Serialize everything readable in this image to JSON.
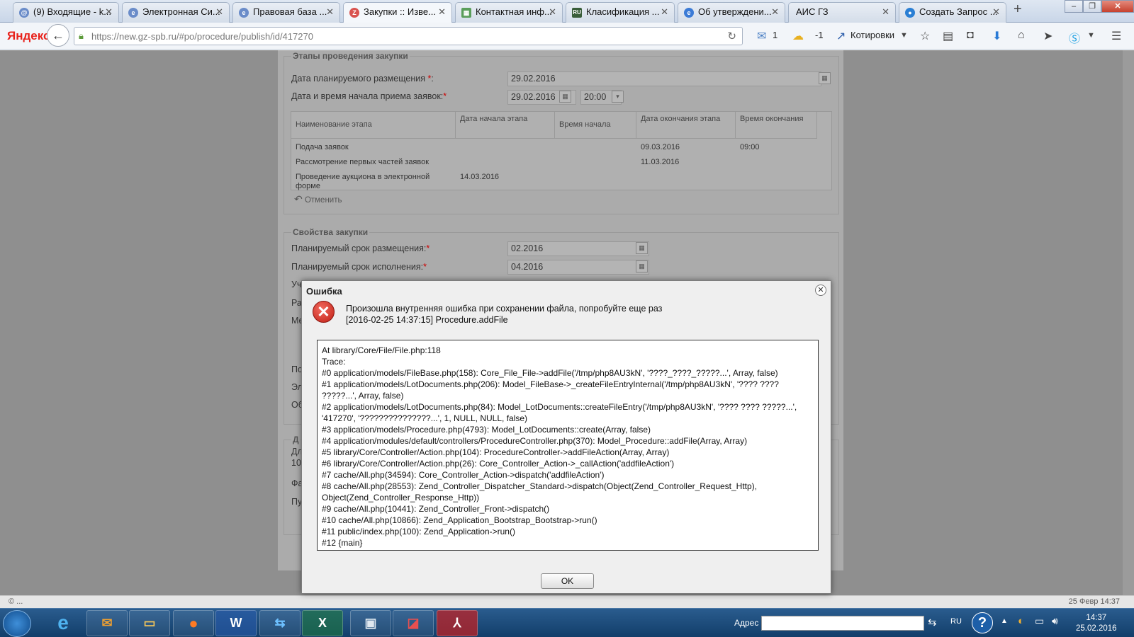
{
  "browser": {
    "tabs": [
      {
        "label": "(9) Входящие - k...",
        "icon": "mail-icon"
      },
      {
        "label": "Электронная Си...",
        "icon": "globe-icon"
      },
      {
        "label": "Правовая база ...",
        "icon": "globe-icon"
      },
      {
        "label": "Закупки :: Изве...",
        "icon": "gz-icon"
      },
      {
        "label": "Контактная инф...",
        "icon": "page-icon"
      },
      {
        "label": "Класификация ...",
        "icon": "ru-icon"
      },
      {
        "label": "Об утверждени...",
        "icon": "e-icon"
      },
      {
        "label": "АИС ГЗ",
        "icon": ""
      },
      {
        "label": "Создать Запрос ...",
        "icon": "globe-icon"
      }
    ],
    "new_tab": "+",
    "logo": "Яндекс",
    "url": "https://new.gz-spb.ru/#po/procedure/publish/id/417270",
    "mail_count": "1",
    "weather": "-1",
    "quotes_label": "Котировки"
  },
  "stages": {
    "legend": "Этапы проведения закупки",
    "planned_date_label": "Дата планируемого размещения",
    "planned_date_suffix": ":",
    "planned_date_value": "29.02.2016",
    "start_label": "Дата и время начала приема заявок:",
    "start_date": "29.02.2016",
    "start_time": "20:00",
    "req_mark": "*",
    "table_headers": [
      "Наименование этапа",
      "Дата начала этапа",
      "Время начала",
      "Дата окончания этапа",
      "Время окончания"
    ],
    "rows": [
      [
        "Подача заявок",
        "",
        "",
        "09.03.2016",
        "09:00"
      ],
      [
        "Рассмотрение первых частей заявок",
        "",
        "",
        "11.03.2016",
        ""
      ],
      [
        "Проведение аукциона в электронной форме",
        "14.03.2016",
        "",
        "",
        ""
      ]
    ],
    "cancel_label": "Отменить"
  },
  "props": {
    "legend": "Свойства закупки",
    "placement_label": "Планируемый срок размещения:",
    "placement_value": "02.2016",
    "execution_label": "Планируемый срок исполнения:",
    "execution_value": "04.2016",
    "partial_labels": [
      "Уч",
      "Ра",
      "Ме",
      "По",
      "Эл",
      "Об"
    ]
  },
  "lower": {
    "legend_partial": "Д",
    "partial_labels": [
      "Дл",
      "10",
      "Фа",
      "Пу"
    ]
  },
  "dialog": {
    "title": "Ошибка",
    "message_line1": "Произошла внутренняя ошибка при сохранении файла, попробуйте еще раз",
    "message_line2": "[2016-02-25 14:37:15] Procedure.addFile",
    "trace_lines": [
      "At library/Core/File/File.php:118",
      "Trace:",
      "#0 application/models/FileBase.php(158): Core_File_File->addFile('/tmp/php8AU3kN', '????_????_?????...', Array, false)",
      "#1 application/models/LotDocuments.php(206): Model_FileBase->_createFileEntryInternal('/tmp/php8AU3kN', '???? ???? ?????...', Array, false)",
      "#2 application/models/LotDocuments.php(84): Model_LotDocuments::createFileEntry('/tmp/php8AU3kN', '???? ???? ?????...', '417270', '???????????????...', 1, NULL, NULL, false)",
      "#3 application/models/Procedure.php(4793): Model_LotDocuments::create(Array, false)",
      "#4 application/modules/default/controllers/ProcedureController.php(370): Model_Procedure::addFile(Array, Array)",
      "#5 library/Core/Controller/Action.php(104): ProcedureController->addFileAction(Array, Array)",
      "#6 library/Core/Controller/Action.php(26): Core_Controller_Action->_callAction('addfileAction')",
      "#7 cache/All.php(34594): Core_Controller_Action->dispatch('addfileAction')",
      "#8 cache/All.php(28553): Zend_Controller_Dispatcher_Standard->dispatch(Object(Zend_Controller_Request_Http), Object(Zend_Controller_Response_Http))",
      "#9 cache/All.php(10441): Zend_Controller_Front->dispatch()",
      "#10 cache/All.php(10866): Zend_Application_Bootstrap_Bootstrap->run()",
      "#11 public/index.php(100): Zend_Application->run()",
      "#12 {main}"
    ],
    "ok_label": "OK"
  },
  "statusbar": {
    "left": "© ...",
    "right": "25 Февр 14:37"
  },
  "taskbar": {
    "address_label": "Адрес",
    "lang": "RU",
    "time": "14:37",
    "date": "25.02.2016",
    "apps": [
      "ie-icon",
      "outlook-icon",
      "explorer-icon",
      "firefox-icon",
      "word-icon",
      "teamviewer-icon",
      "excel-icon",
      "network-icon",
      "app-icon",
      "acrobat-icon"
    ]
  }
}
